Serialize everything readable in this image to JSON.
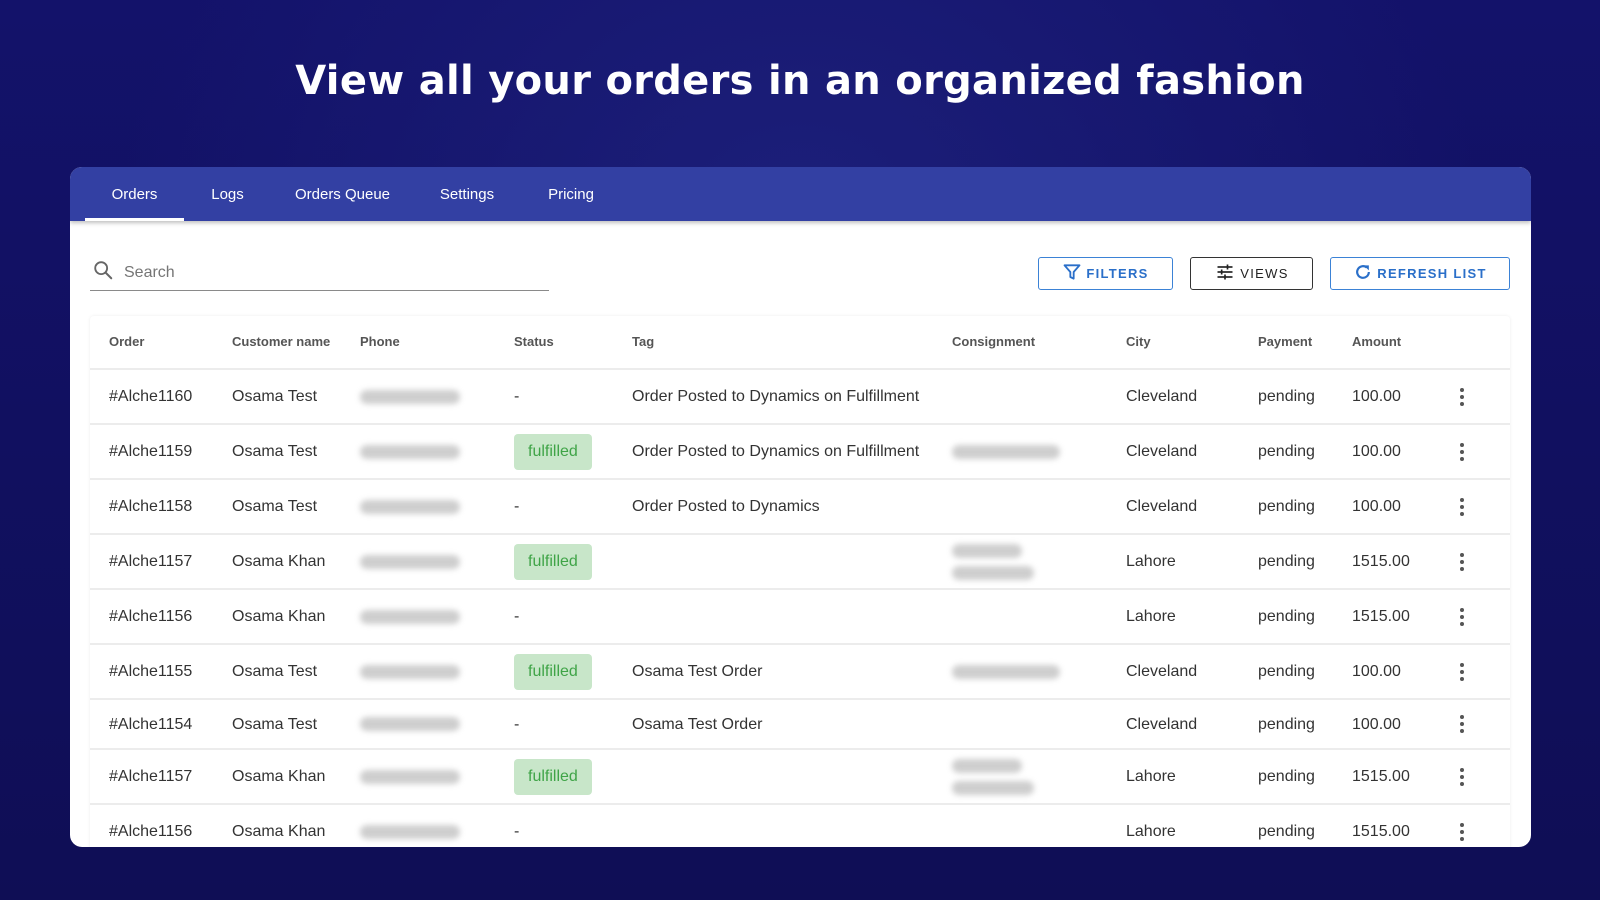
{
  "headline": "View all your orders in an organized fashion",
  "tabs": [
    {
      "label": "Orders",
      "active": true
    },
    {
      "label": "Logs",
      "active": false
    },
    {
      "label": "Orders Queue",
      "active": false
    },
    {
      "label": "Settings",
      "active": false
    },
    {
      "label": "Pricing",
      "active": false
    }
  ],
  "search": {
    "placeholder": "Search",
    "value": "",
    "icon": "search-icon"
  },
  "buttons": {
    "filters": {
      "label": "FILTERS",
      "icon": "filter-icon"
    },
    "views": {
      "label": "VIEWS",
      "icon": "sliders-icon"
    },
    "refresh": {
      "label": "REFRESH LIST",
      "icon": "refresh-icon"
    }
  },
  "colors": {
    "accent": "#3340a3",
    "button_blue": "#2a6fc9",
    "badge_bg": "#c8e6c9",
    "badge_text": "#3fa447",
    "background": "#11105a"
  },
  "table": {
    "columns": [
      "Order",
      "Customer name",
      "Phone",
      "Status",
      "Tag",
      "Consignment",
      "City",
      "Payment",
      "Amount"
    ],
    "rows": [
      {
        "order": "#Alche1160",
        "customer": "Osama Test",
        "phone": "[redacted]",
        "status": "-",
        "tag": "Order Posted to Dynamics on Fulfillment",
        "consignment": "",
        "city": "Cleveland",
        "payment": "pending",
        "amount": "100.00"
      },
      {
        "order": "#Alche1159",
        "customer": "Osama Test",
        "phone": "[redacted]",
        "status": "fulfilled",
        "tag": "Order Posted to Dynamics on Fulfillment",
        "consignment": "[redacted]",
        "city": "Cleveland",
        "payment": "pending",
        "amount": "100.00"
      },
      {
        "order": "#Alche1158",
        "customer": "Osama Test",
        "phone": "[redacted]",
        "status": "-",
        "tag": "Order Posted to Dynamics",
        "consignment": "",
        "city": "Cleveland",
        "payment": "pending",
        "amount": "100.00"
      },
      {
        "order": "#Alche1157",
        "customer": "Osama Khan",
        "phone": "[redacted]",
        "status": "fulfilled",
        "tag": "",
        "consignment": "[redacted-2line]",
        "city": "Lahore",
        "payment": "pending",
        "amount": "1515.00"
      },
      {
        "order": "#Alche1156",
        "customer": "Osama Khan",
        "phone": "[redacted]",
        "status": "-",
        "tag": "",
        "consignment": "",
        "city": "Lahore",
        "payment": "pending",
        "amount": "1515.00"
      },
      {
        "order": "#Alche1155",
        "customer": "Osama Test",
        "phone": "[redacted]",
        "status": "fulfilled",
        "tag": "Osama Test Order",
        "consignment": "[redacted]",
        "city": "Cleveland",
        "payment": "pending",
        "amount": "100.00"
      },
      {
        "order": "#Alche1154",
        "customer": "Osama Test",
        "phone": "[redacted]",
        "status": "-",
        "tag": "Osama Test Order",
        "consignment": "",
        "city": "Cleveland",
        "payment": "pending",
        "amount": "100.00"
      },
      {
        "order": "#Alche1157",
        "customer": "Osama Khan",
        "phone": "[redacted]",
        "status": "fulfilled",
        "tag": "",
        "consignment": "[redacted-2line]",
        "city": "Lahore",
        "payment": "pending",
        "amount": "1515.00"
      },
      {
        "order": "#Alche1156",
        "customer": "Osama Khan",
        "phone": "[redacted]",
        "status": "-",
        "tag": "",
        "consignment": "",
        "city": "Lahore",
        "payment": "pending",
        "amount": "1515.00"
      }
    ]
  }
}
